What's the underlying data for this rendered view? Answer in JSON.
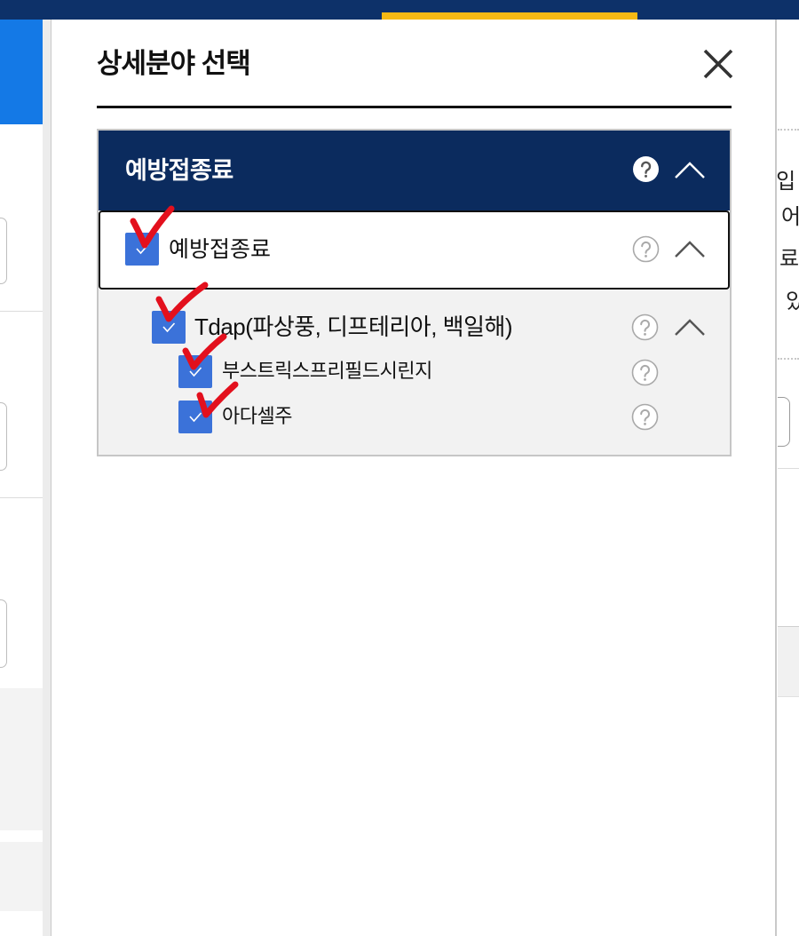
{
  "modal": {
    "title": "상세분야 선택"
  },
  "tree": {
    "header": {
      "label": "예방접종료",
      "expanded": true
    },
    "items": [
      {
        "label": "예방접종료",
        "checked": true,
        "expanded": true,
        "children": [
          {
            "label": "Tdap(파상풍, 디프테리아, 백일해)",
            "checked": true,
            "expanded": true,
            "children": [
              {
                "label": "부스트릭스프리필드시린지",
                "checked": true
              },
              {
                "label": "아다셀주",
                "checked": true
              }
            ]
          }
        ]
      }
    ]
  },
  "background": {
    "right_text": [
      "투입",
      "어",
      "료",
      "있"
    ]
  },
  "icons": {
    "close": "close-icon",
    "help": "question-circle-icon",
    "toggle": "chevron-up-icon",
    "checkbox": "check-icon",
    "annotation": "red-checkmark-annotation"
  },
  "colors": {
    "top_bar": "#0d3169",
    "top_tab": "#f6b914",
    "left_panel": "#1479e6",
    "tree_header_bg": "#0b2b5e",
    "tree_body_bg": "#f2f2f2",
    "checkbox": "#3b72d9",
    "annotation": "#e3101d"
  }
}
